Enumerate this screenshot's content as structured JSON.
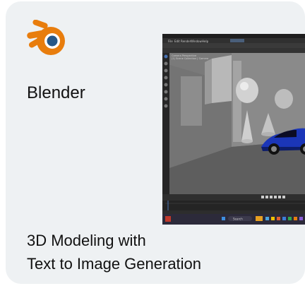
{
  "card": {
    "app_name": "Blender",
    "description_line1": "3D Modeling with",
    "description_line2": "Text to Image Generation"
  },
  "screenshot": {
    "menu_items": [
      "File",
      "Edit",
      "Render",
      "Window",
      "Help"
    ],
    "viewport_label_line1": "Camera Perspective",
    "viewport_label_line2": "(1) Scene Collection | Camera",
    "taskbar_search": "Search"
  },
  "colors": {
    "blender_orange": "#e87d0d",
    "blender_blue": "#265787",
    "card_bg": "#eef1f3",
    "car_blue": "#1b36b8"
  }
}
